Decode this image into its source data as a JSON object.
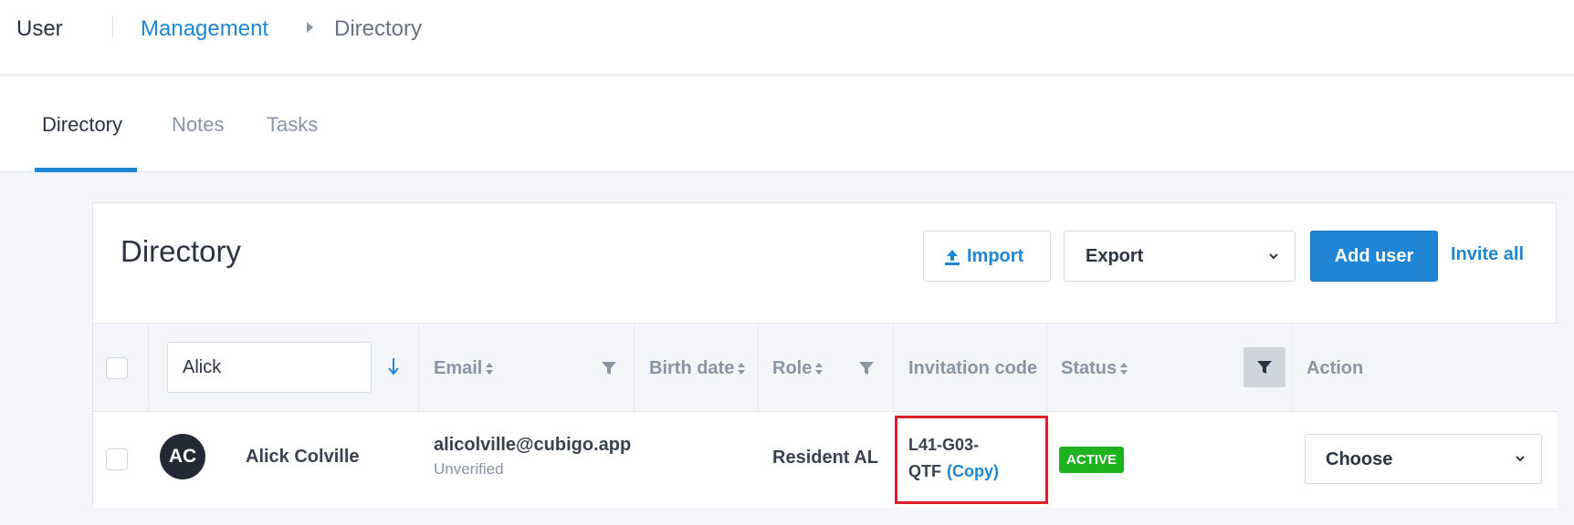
{
  "header": {
    "app_title": "User",
    "breadcrumb": {
      "link": "Management",
      "current": "Directory"
    }
  },
  "tabs": [
    {
      "label": "Directory",
      "active": true
    },
    {
      "label": "Notes",
      "active": false
    },
    {
      "label": "Tasks",
      "active": false
    }
  ],
  "directory": {
    "title": "Directory",
    "import_label": "Import",
    "export_label": "Export",
    "add_user_label": "Add user",
    "invite_all_label": "Invite all"
  },
  "table": {
    "name_search_value": "Alick",
    "columns": {
      "email": "Email",
      "birth_date": "Birth date",
      "role": "Role",
      "invitation_code": "Invitation code",
      "status": "Status",
      "action": "Action"
    },
    "rows": [
      {
        "initials": "AC",
        "name": "Alick Colville",
        "email": "alicolville@cubigo.app",
        "email_status": "Unverified",
        "birth_date": "",
        "role": "Resident AL",
        "invitation_code_line1": "L41-G03-",
        "invitation_code_line2": "QTF",
        "copy_label": "(Copy)",
        "status": "ACTIVE",
        "action_label": "Choose"
      }
    ]
  },
  "colors": {
    "accent": "#1f86d6",
    "status_active": "#1db31f",
    "highlight": "#e11d2b",
    "avatar_bg": "#232a36"
  },
  "icons": [
    "upload-icon",
    "chevron-down-icon",
    "filter-icon",
    "sort-icon",
    "sort-down-arrow-icon",
    "caret-right-icon"
  ]
}
